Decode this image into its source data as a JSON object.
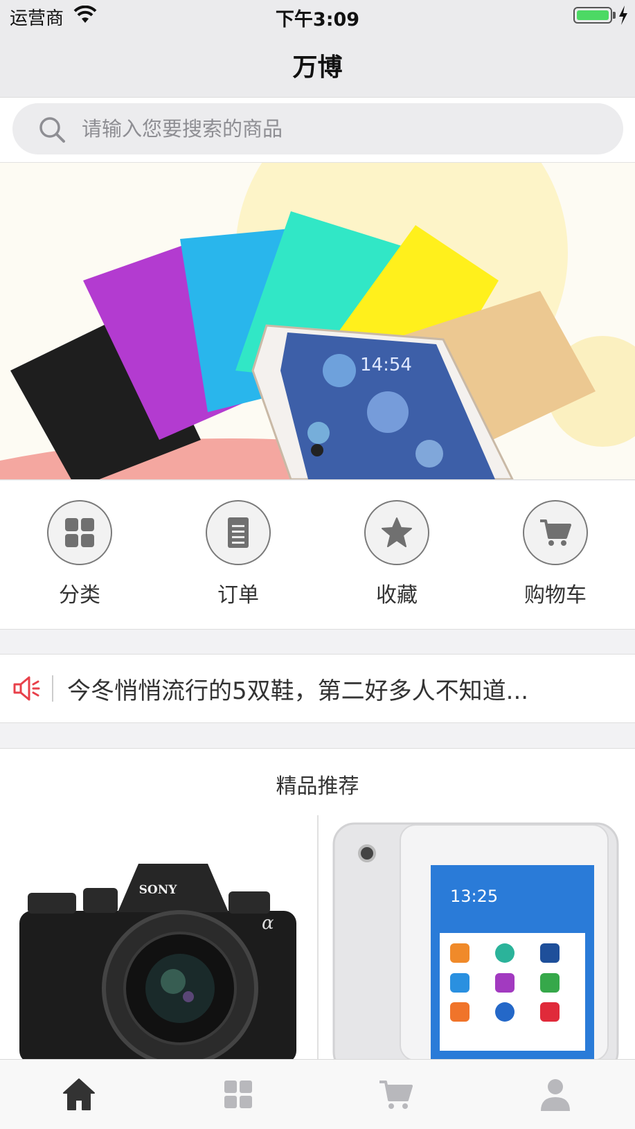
{
  "status_bar": {
    "carrier": "运营商",
    "time": "下午3:09"
  },
  "nav": {
    "title": "万博"
  },
  "search": {
    "placeholder": "请输入您要搜索的商品"
  },
  "menu": [
    {
      "label": "分类",
      "icon": "grid-icon"
    },
    {
      "label": "订单",
      "icon": "document-icon"
    },
    {
      "label": "收藏",
      "icon": "star-icon"
    },
    {
      "label": "购物车",
      "icon": "cart-icon"
    }
  ],
  "notice": {
    "text": "今冬悄悄流行的5双鞋，第二好多人不知道...",
    "icon": "speaker-icon"
  },
  "section": {
    "title": "精品推荐"
  },
  "products": [
    {
      "image": "sony-camera",
      "brand": "SONY"
    },
    {
      "image": "learning-tablet",
      "screen_time": "13:25"
    }
  ],
  "banner": {
    "screen_time": "14:54"
  },
  "tabbar": [
    {
      "icon": "home-icon",
      "active": true
    },
    {
      "icon": "grid-icon",
      "active": false
    },
    {
      "icon": "cart-icon",
      "active": false
    },
    {
      "icon": "user-icon",
      "active": false
    }
  ],
  "colors": {
    "accent_red": "#e8404a",
    "tab_active": "#333333",
    "tab_inactive": "#b8b8bc"
  }
}
